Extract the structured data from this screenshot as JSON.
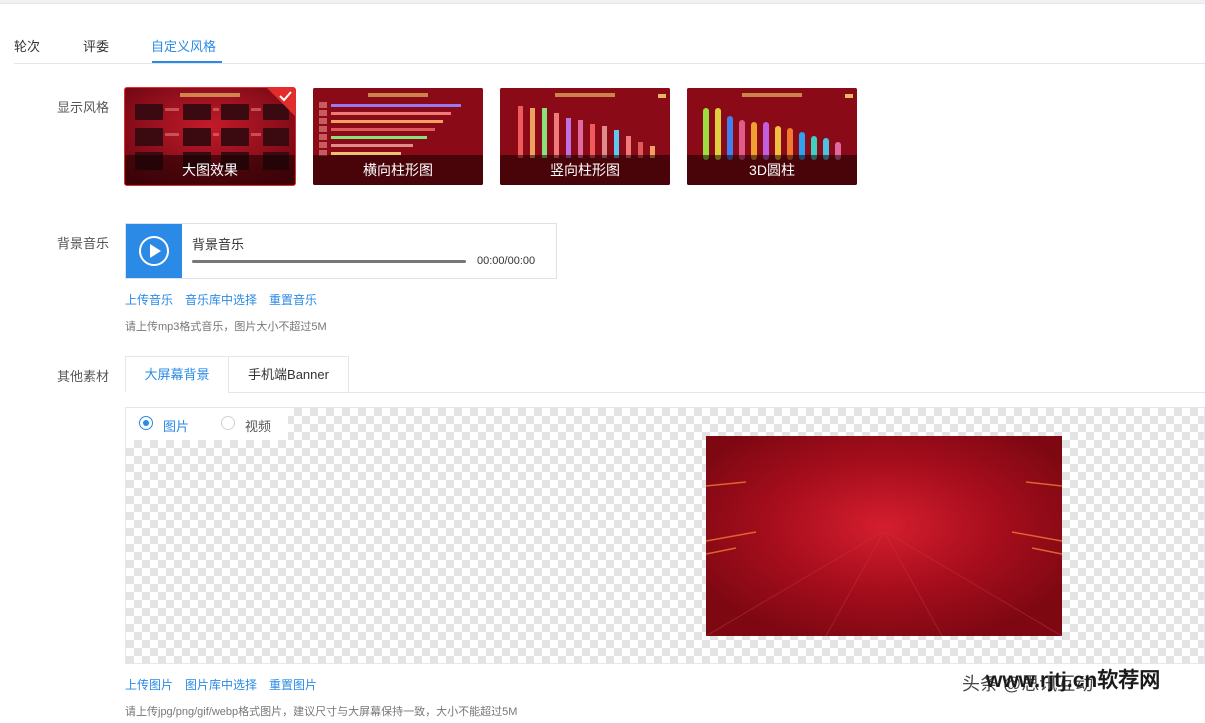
{
  "tabs": [
    {
      "label": "轮次",
      "active": false
    },
    {
      "label": "评委",
      "active": false
    },
    {
      "label": "自定义风格",
      "active": true
    }
  ],
  "display_style": {
    "label": "显示风格",
    "options": [
      {
        "caption": "大图效果",
        "selected": true
      },
      {
        "caption": "横向柱形图",
        "selected": false
      },
      {
        "caption": "竖向柱形图",
        "selected": false
      },
      {
        "caption": "3D圆柱",
        "selected": false
      }
    ]
  },
  "music": {
    "label": "背景音乐",
    "player_title": "背景音乐",
    "time": "00:00/00:00",
    "links": [
      "上传音乐",
      "音乐库中选择",
      "重置音乐"
    ],
    "hint": "请上传mp3格式音乐，图片大小不超过5M"
  },
  "materials": {
    "label": "其他素材",
    "tabs": [
      {
        "label": "大屏幕背景",
        "active": true
      },
      {
        "label": "手机端Banner",
        "active": false
      }
    ],
    "media_type": [
      {
        "label": "图片",
        "checked": true
      },
      {
        "label": "视频",
        "checked": false
      }
    ],
    "links": [
      "上传图片",
      "图片库中选择",
      "重置图片"
    ],
    "hint": "请上传jpg/png/gif/webp格式图片，建议尺寸与大屏幕保持一致，大小不能超过5M"
  },
  "watermark": {
    "site": "www.rjtj.cn软荐网",
    "author": "头条 @思讯互动"
  },
  "colors": {
    "accent": "#2a8ae6",
    "selected_border": "#e32d2d",
    "theme_red": "#8d0a1a"
  }
}
